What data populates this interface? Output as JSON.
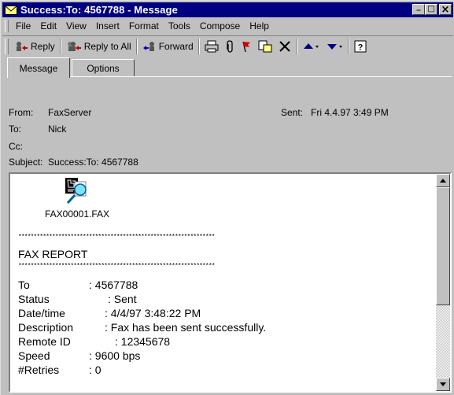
{
  "window": {
    "title": "Success:To: 4567788 - Message",
    "minimize": "_",
    "maximize": "□",
    "close": "×"
  },
  "menu": [
    "File",
    "Edit",
    "View",
    "Insert",
    "Format",
    "Tools",
    "Compose",
    "Help"
  ],
  "toolbar": {
    "reply": "Reply",
    "reply_all": "Reply to All",
    "forward": "Forward"
  },
  "tabs": [
    "Message",
    "Options"
  ],
  "header": {
    "from_label": "From:",
    "from_value": "FaxServer",
    "sent_label": "Sent:",
    "sent_value": "Fri 4.4.97 3:49 PM",
    "to_label": "To:",
    "to_value": "Nick",
    "cc_label": "Cc:",
    "cc_value": "",
    "subject_label": "Subject:",
    "subject_value": "Success:To: 4567788"
  },
  "attachment": {
    "filename": "FAX00001.FAX"
  },
  "body": {
    "stars": "****************************************************************",
    "report_title": "FAX REPORT",
    "fields": [
      {
        "label": "To",
        "value": ": 4567788"
      },
      {
        "label": "Status",
        "value": ": Sent"
      },
      {
        "label": "Date/time",
        "value": ": 4/4/97  3:48:22 PM"
      },
      {
        "label": "Description",
        "value": ": Fax has been sent successfully."
      },
      {
        "label": "Remote ID",
        "value": ": 12345678"
      },
      {
        "label": "Speed",
        "value": ": 9600 bps"
      },
      {
        "label": "#Retries",
        "value": ": 0"
      }
    ]
  }
}
